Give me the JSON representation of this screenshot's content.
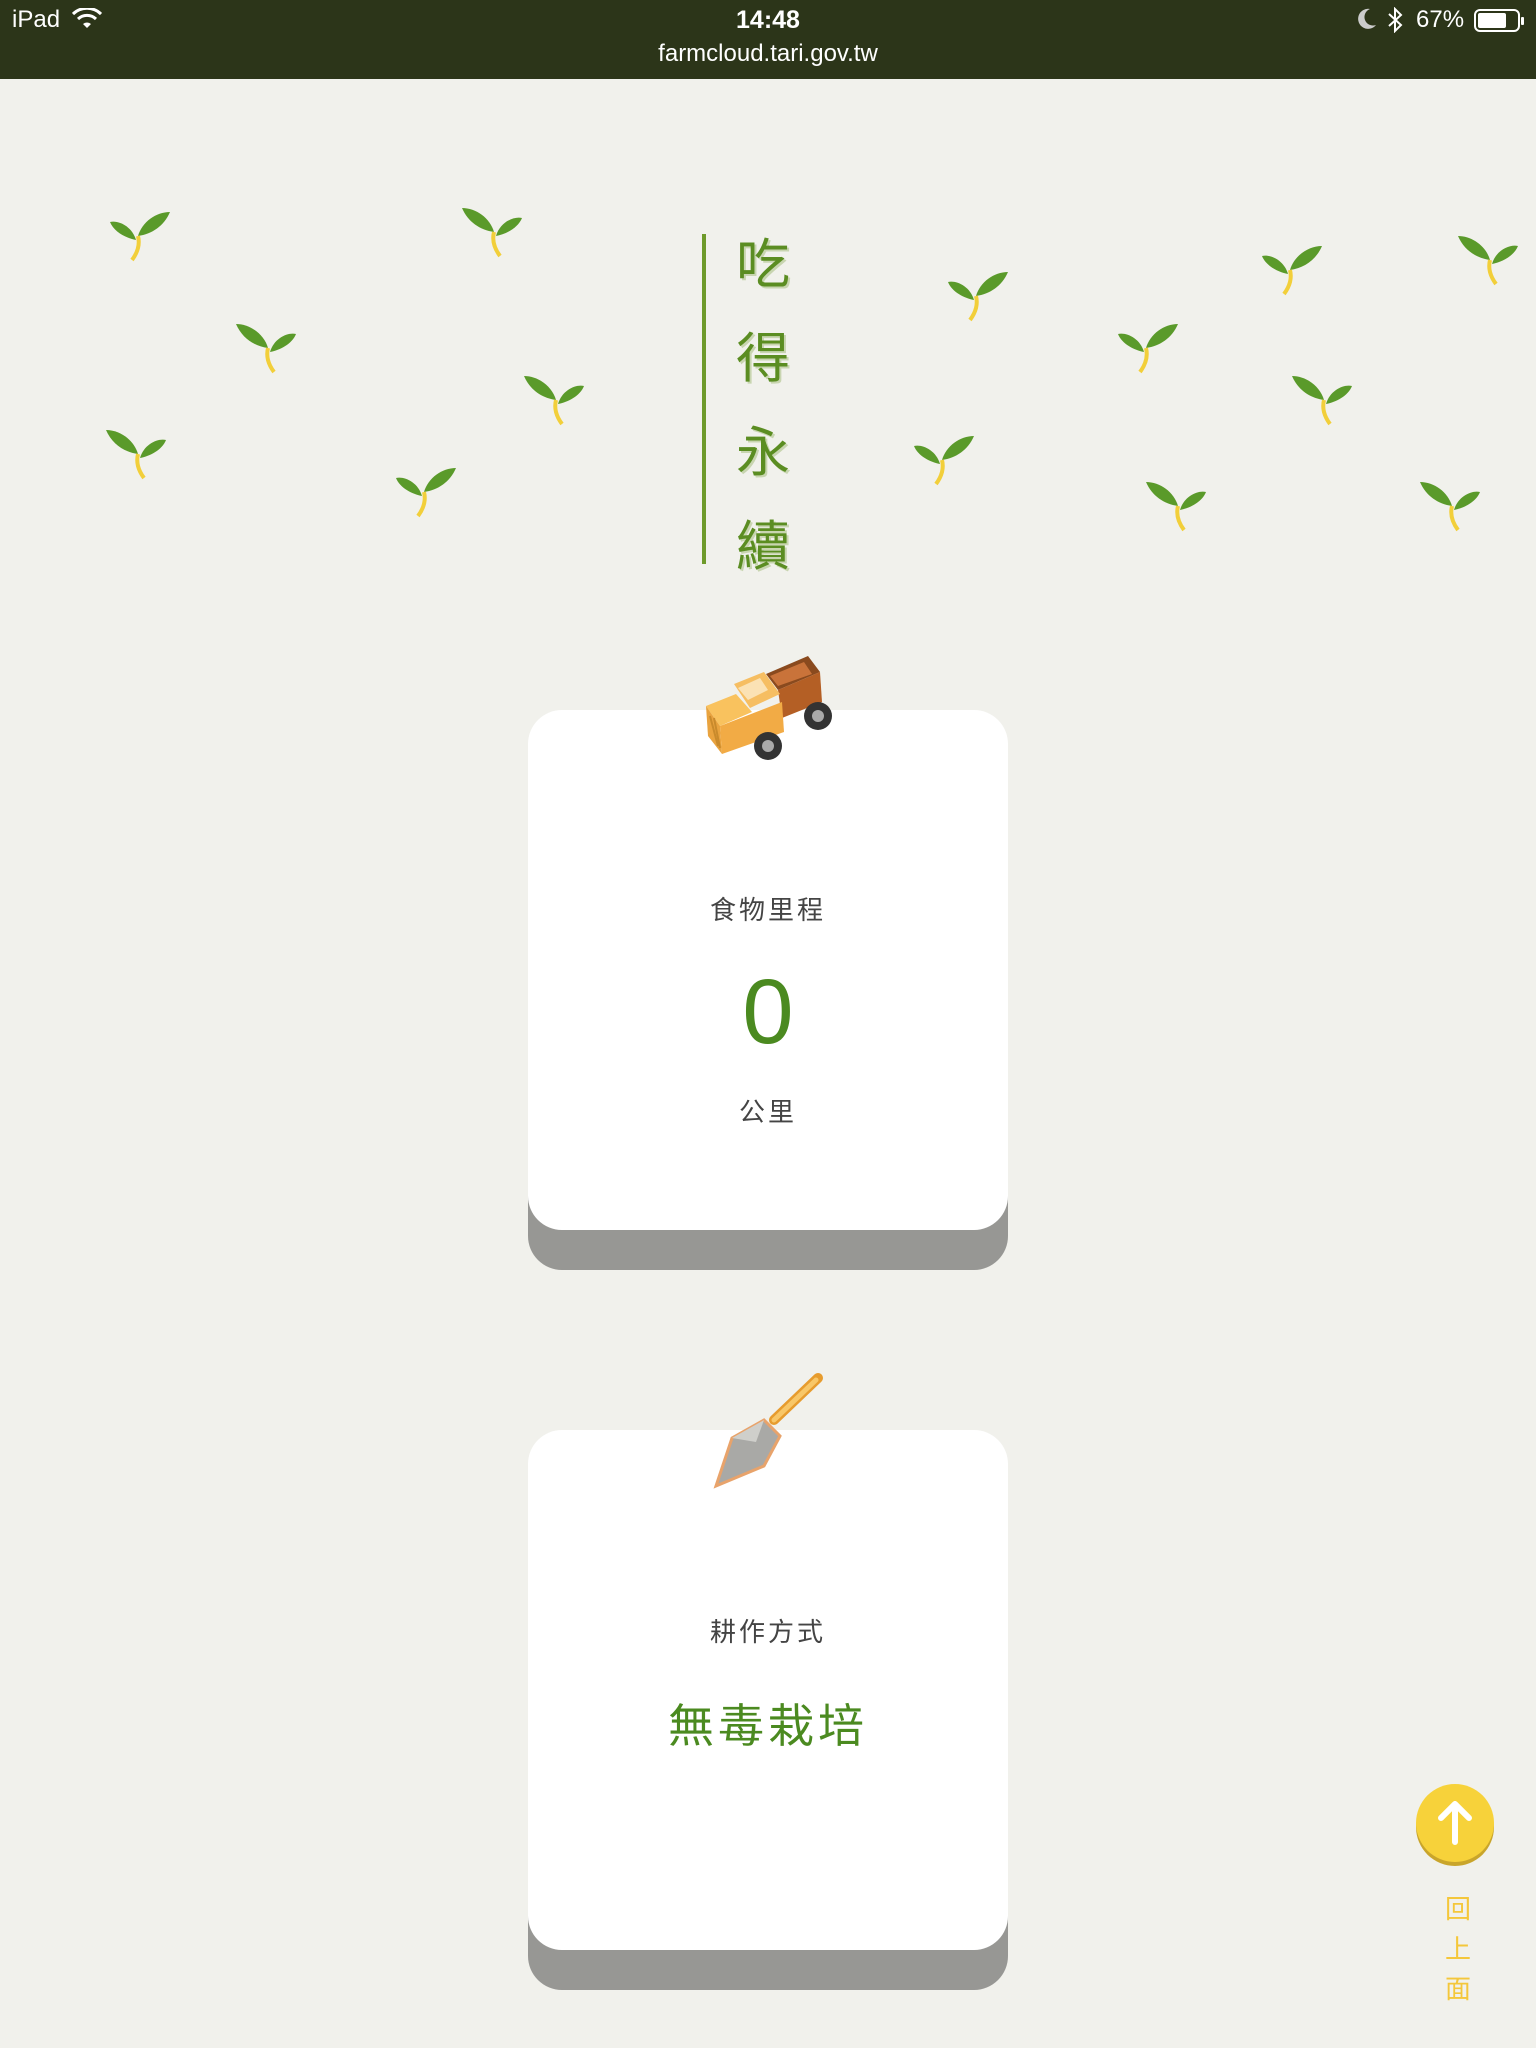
{
  "status_bar": {
    "device": "iPad",
    "time": "14:48",
    "url": "farmcloud.tari.gov.tw",
    "battery_percent": "67%",
    "icons": [
      "wifi-icon",
      "moon-icon",
      "bluetooth-icon",
      "battery-icon"
    ]
  },
  "hero": {
    "title_chars": [
      "吃",
      "得",
      "永",
      "續"
    ],
    "decoration": "sprout-icon"
  },
  "cards": [
    {
      "icon": "truck-icon",
      "label": "食物里程",
      "value": "0",
      "unit": "公里"
    },
    {
      "icon": "shovel-icon",
      "label": "耕作方式",
      "value": "無毒栽培"
    }
  ],
  "back_to_top": {
    "icon": "arrow-up-icon",
    "label_chars": [
      "回",
      "上",
      "面"
    ]
  },
  "colors": {
    "status_bar_bg": "#2c3519",
    "page_bg": "#f1f1ec",
    "accent_green": "#4b8a20",
    "leaf_green": "#5a9a2a",
    "button_yellow": "#f7d23a"
  }
}
